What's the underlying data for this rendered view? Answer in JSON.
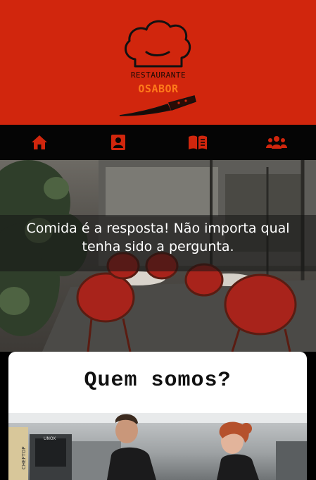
{
  "header": {
    "logo_top": "RESTAURANTE",
    "logo_name": "OSABOR",
    "bg_color": "#d1260d",
    "accent_color": "#ff7a1a"
  },
  "nav": {
    "items": [
      {
        "icon": "home-icon"
      },
      {
        "icon": "contact-card-icon"
      },
      {
        "icon": "menu-book-icon"
      },
      {
        "icon": "users-icon"
      }
    ],
    "icon_color": "#d1260d"
  },
  "hero": {
    "text": "Comida é a resposta! Não importa qual tenha sido a pergunta."
  },
  "about": {
    "title": "Quem somos?",
    "sign_text": "CHEFTOP",
    "oven_brand": "UNOX"
  }
}
